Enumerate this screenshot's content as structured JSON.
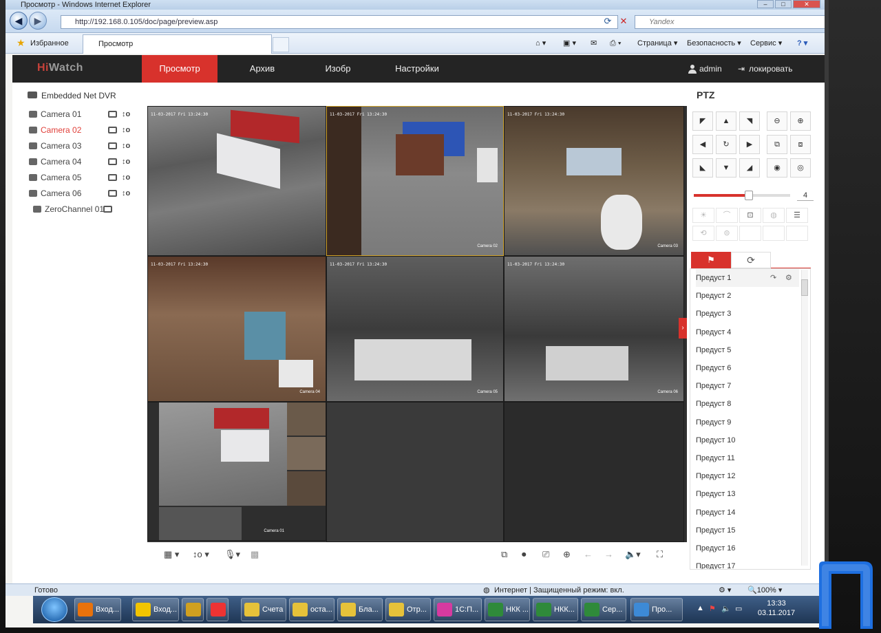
{
  "browser": {
    "window_title": "Просмотр - Windows Internet Explorer",
    "address": "http://192.168.0.105/doc/page/preview.asp",
    "search_placeholder": "Yandex",
    "favorites_label": "Избранное",
    "tab_title": "Просмотр",
    "commands": [
      "Страница",
      "Безопасность",
      "Сервис"
    ],
    "status_left": "Готово",
    "status_zone": "Интернет | Защищенный режим: вкл.",
    "zoom": "100%"
  },
  "app": {
    "logo_hi": "Hi",
    "logo_watch": "Watch",
    "tabs": [
      "Просмотр",
      "Архив",
      "Изобр",
      "Настройки"
    ],
    "active_tab": 0,
    "user": "admin",
    "lock_label": "локировать"
  },
  "tree": {
    "device": "Embedded Net DVR",
    "cameras": [
      {
        "label": "Camera 01",
        "selected": false
      },
      {
        "label": "Camera 02",
        "selected": true
      },
      {
        "label": "Camera 03",
        "selected": false
      },
      {
        "label": "Camera 04",
        "selected": false
      },
      {
        "label": "Camera 05",
        "selected": false
      },
      {
        "label": "Camera 06",
        "selected": false
      }
    ],
    "zero_channel": "ZeroChannel 01"
  },
  "video": {
    "timestamp": "11-03-2017 Fri 13:24:30",
    "tiles": [
      {
        "name": "",
        "scene": "yard-truck"
      },
      {
        "name": "Camera 02",
        "scene": "loading-dock"
      },
      {
        "name": "Camera 03",
        "scene": "warehouse"
      },
      {
        "name": "Camera 04",
        "scene": "warehouse-color"
      },
      {
        "name": "Camera 05",
        "scene": "warehouse-ir"
      },
      {
        "name": "Camera 06",
        "scene": "warehouse-ir"
      },
      {
        "name": "Camera 01",
        "scene": "zero-channel"
      }
    ]
  },
  "ptz": {
    "title": "PTZ",
    "speed": 4,
    "speed_max": 7,
    "presets": [
      "Предуст 1",
      "Предуст 2",
      "Предуст 3",
      "Предуст 4",
      "Предуст 5",
      "Предуст 6",
      "Предуст 7",
      "Предуст 8",
      "Предуст 9",
      "Предуст 10",
      "Предуст 11",
      "Предуст 12",
      "Предуст 13",
      "Предуст 14",
      "Предуст 15",
      "Предуст 16",
      "Предуст 17"
    ]
  },
  "taskbar": {
    "apps": [
      "Вход...",
      "Вход...",
      "Счета",
      "оста...",
      "Бла...",
      "Отр...",
      "1С:П...",
      "НКК ...",
      "НКК...",
      "Сер...",
      "Про..."
    ],
    "time": "13:33",
    "date": "03.11.2017"
  }
}
